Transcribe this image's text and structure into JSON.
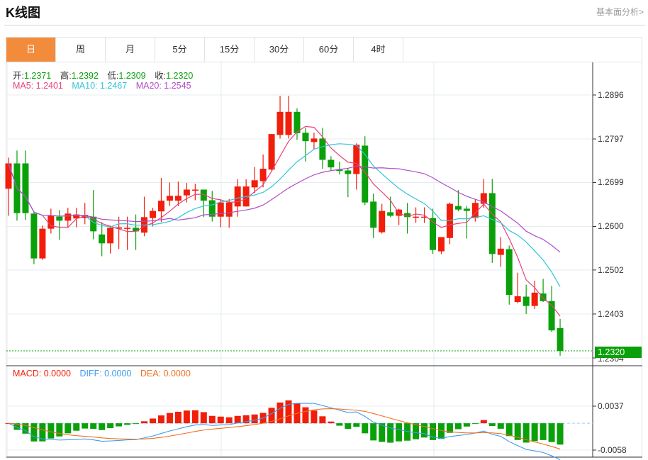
{
  "header": {
    "title": "K线图",
    "link": "基本面分析>"
  },
  "tabs": [
    {
      "label": "日",
      "active": true
    },
    {
      "label": "周"
    },
    {
      "label": "月"
    },
    {
      "label": "5分"
    },
    {
      "label": "15分"
    },
    {
      "label": "30分"
    },
    {
      "label": "60分"
    },
    {
      "label": "4时"
    }
  ],
  "ohlc_legend": {
    "open_label": "开:",
    "open": "1.2371",
    "high_label": "高:",
    "high": "1.2392",
    "low_label": "低:",
    "low": "1.2309",
    "close_label": "收:",
    "close": "1.2320"
  },
  "ma_legend": {
    "ma5": "MA5: 1.2401",
    "ma10": "MA10: 1.2467",
    "ma20": "MA20: 1.2545"
  },
  "macd_legend": {
    "macd": "MACD: 0.0000",
    "diff": "DIFF: 0.0000",
    "dea": "DEA: 0.0000"
  },
  "colors": {
    "up": "#f01e0a",
    "down": "#0aa00a",
    "ma5": "#e8427a",
    "ma10": "#30c5d8",
    "ma20": "#b04cc8",
    "diff": "#3d9bf0",
    "dea": "#f07020",
    "tab_active": "#f28c3c"
  },
  "chart_data": {
    "type": "candlestick",
    "price_ticks": [
      "1.2896",
      "1.2797",
      "1.2699",
      "1.2600",
      "1.2502",
      "1.2403",
      "1.2304"
    ],
    "price_range": [
      1.2304,
      1.2896
    ],
    "last_price": "1.2320",
    "macd_ticks": [
      "0.0037",
      "-0.0058"
    ],
    "macd_range": [
      -0.0058,
      0.0037
    ],
    "candles": [
      [
        1.2685,
        1.2755,
        1.2624,
        1.2742
      ],
      [
        1.2742,
        1.2771,
        1.2613,
        1.263
      ],
      [
        1.2742,
        1.2771,
        1.2614,
        1.263
      ],
      [
        1.2629,
        1.2632,
        1.2515,
        1.2528
      ],
      [
        1.2528,
        1.2602,
        1.2525,
        1.2595
      ],
      [
        1.2595,
        1.264,
        1.2584,
        1.2624
      ],
      [
        1.2622,
        1.2637,
        1.257,
        1.2613
      ],
      [
        1.2613,
        1.2642,
        1.2598,
        1.2629
      ],
      [
        1.2618,
        1.2642,
        1.2598,
        1.2627
      ],
      [
        1.2619,
        1.2653,
        1.2605,
        1.2626
      ],
      [
        1.2622,
        1.2682,
        1.2571,
        1.2589
      ],
      [
        1.2582,
        1.261,
        1.2533,
        1.2562
      ],
      [
        1.2562,
        1.2602,
        1.2539,
        1.2597
      ],
      [
        1.2595,
        1.2622,
        1.2549,
        1.2598
      ],
      [
        1.2595,
        1.2622,
        1.2547,
        1.2597
      ],
      [
        1.2597,
        1.2627,
        1.2547,
        1.2589
      ],
      [
        1.2586,
        1.2667,
        1.2578,
        1.2621
      ],
      [
        1.2619,
        1.2642,
        1.26,
        1.2635
      ],
      [
        1.2634,
        1.2709,
        1.261,
        1.2658
      ],
      [
        1.2658,
        1.2699,
        1.2646,
        1.2669
      ],
      [
        1.2658,
        1.2701,
        1.2646,
        1.2669
      ],
      [
        1.267,
        1.2698,
        1.2654,
        1.2683
      ],
      [
        1.2682,
        1.2696,
        1.2659,
        1.2683
      ],
      [
        1.2683,
        1.2683,
        1.2621,
        1.2658
      ],
      [
        1.2659,
        1.268,
        1.2611,
        1.2622
      ],
      [
        1.2622,
        1.2661,
        1.2598,
        1.2654
      ],
      [
        1.2622,
        1.2662,
        1.2597,
        1.2654
      ],
      [
        1.2645,
        1.2706,
        1.2622,
        1.269
      ],
      [
        1.2645,
        1.2706,
        1.2645,
        1.269
      ],
      [
        1.2688,
        1.2734,
        1.2675,
        1.2704
      ],
      [
        1.2702,
        1.2762,
        1.2688,
        1.273
      ],
      [
        1.2728,
        1.2808,
        1.2726,
        1.2808
      ],
      [
        1.2806,
        1.2894,
        1.2798,
        1.2858
      ],
      [
        1.2806,
        1.2894,
        1.2798,
        1.2858
      ],
      [
        1.2858,
        1.2866,
        1.2795,
        1.281
      ],
      [
        1.2811,
        1.2822,
        1.2746,
        1.2792
      ],
      [
        1.279,
        1.2811,
        1.2774,
        1.2798
      ],
      [
        1.2798,
        1.2822,
        1.273,
        1.275
      ],
      [
        1.275,
        1.2758,
        1.2725,
        1.2733
      ],
      [
        1.2728,
        1.2746,
        1.2717,
        1.2725
      ],
      [
        1.2726,
        1.2731,
        1.2666,
        1.2718
      ],
      [
        1.2718,
        1.2787,
        1.2683,
        1.2784
      ],
      [
        1.2782,
        1.2803,
        1.2648,
        1.2654
      ],
      [
        1.2656,
        1.2674,
        1.2574,
        1.2597
      ],
      [
        1.2587,
        1.2651,
        1.2584,
        1.2635
      ],
      [
        1.2632,
        1.2667,
        1.2621,
        1.2624
      ],
      [
        1.2624,
        1.264,
        1.2603,
        1.2638
      ],
      [
        1.263,
        1.2653,
        1.2584,
        1.2621
      ],
      [
        1.2621,
        1.2643,
        1.2608,
        1.2622
      ],
      [
        1.2621,
        1.2643,
        1.2608,
        1.2622
      ],
      [
        1.2619,
        1.264,
        1.2538,
        1.2547
      ],
      [
        1.2544,
        1.2576,
        1.2538,
        1.2576
      ],
      [
        1.2574,
        1.2654,
        1.256,
        1.2651
      ],
      [
        1.2646,
        1.2682,
        1.2634,
        1.2638
      ],
      [
        1.264,
        1.2646,
        1.2573,
        1.2635
      ],
      [
        1.2619,
        1.2661,
        1.2611,
        1.2653
      ],
      [
        1.2651,
        1.2707,
        1.2642,
        1.2675
      ],
      [
        1.2675,
        1.2707,
        1.2518,
        1.2538
      ],
      [
        1.2536,
        1.2576,
        1.2509,
        1.255
      ],
      [
        1.2549,
        1.2557,
        1.2424,
        1.2446
      ],
      [
        1.243,
        1.2496,
        1.2427,
        1.2443
      ],
      [
        1.2442,
        1.2469,
        1.2403,
        1.2421
      ],
      [
        1.2421,
        1.2478,
        1.2414,
        1.2451
      ],
      [
        1.2449,
        1.2482,
        1.243,
        1.2432
      ],
      [
        1.2432,
        1.2466,
        1.2363,
        1.2366
      ],
      [
        1.2371,
        1.2392,
        1.2309,
        1.232
      ]
    ],
    "candle_format": [
      "open",
      "high",
      "low",
      "close"
    ]
  }
}
